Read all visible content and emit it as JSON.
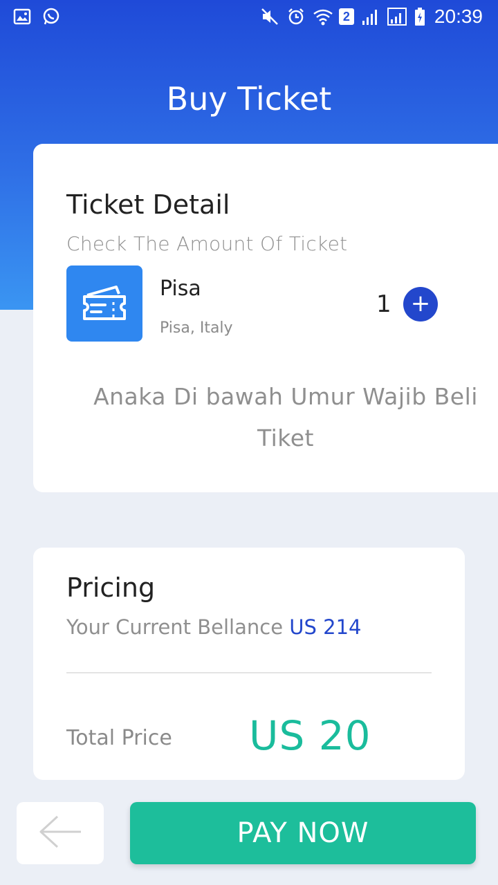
{
  "status_bar": {
    "time": "20:39",
    "sim_badge": "2",
    "left_icons": [
      "gallery-icon",
      "whatsapp-icon"
    ],
    "right_icons": [
      "mute-icon",
      "alarm-icon",
      "wifi-icon",
      "signal-icon",
      "signal-icon",
      "battery-charging-icon"
    ]
  },
  "header": {
    "title": "Buy Ticket"
  },
  "ticket_card": {
    "title": "Ticket Detail",
    "subtitle": "Check The Amount Of Ticket",
    "item": {
      "name": "Pisa",
      "location": "Pisa, Italy",
      "quantity": "1",
      "icon": "ticket-icon"
    },
    "note": "Anaka Di bawah Umur Wajib Beli Tiket"
  },
  "pricing_card": {
    "title": "Pricing",
    "balance_label": "Your Current Bellance",
    "balance_value": "US 214",
    "total_label": "Total Price",
    "total_value": "US 20"
  },
  "footer": {
    "back_icon": "arrow-left-icon",
    "pay_label": "PAY NOW"
  },
  "colors": {
    "header_gradient_top": "#1f4ad8",
    "header_gradient_bottom": "#3a95f2",
    "accent_blue": "#2347cc",
    "pay_button": "#1dbe9b",
    "total_price": "#1abc9c",
    "ticket_icon_bg": "#2f87f0",
    "page_bg": "#ebeff6"
  }
}
